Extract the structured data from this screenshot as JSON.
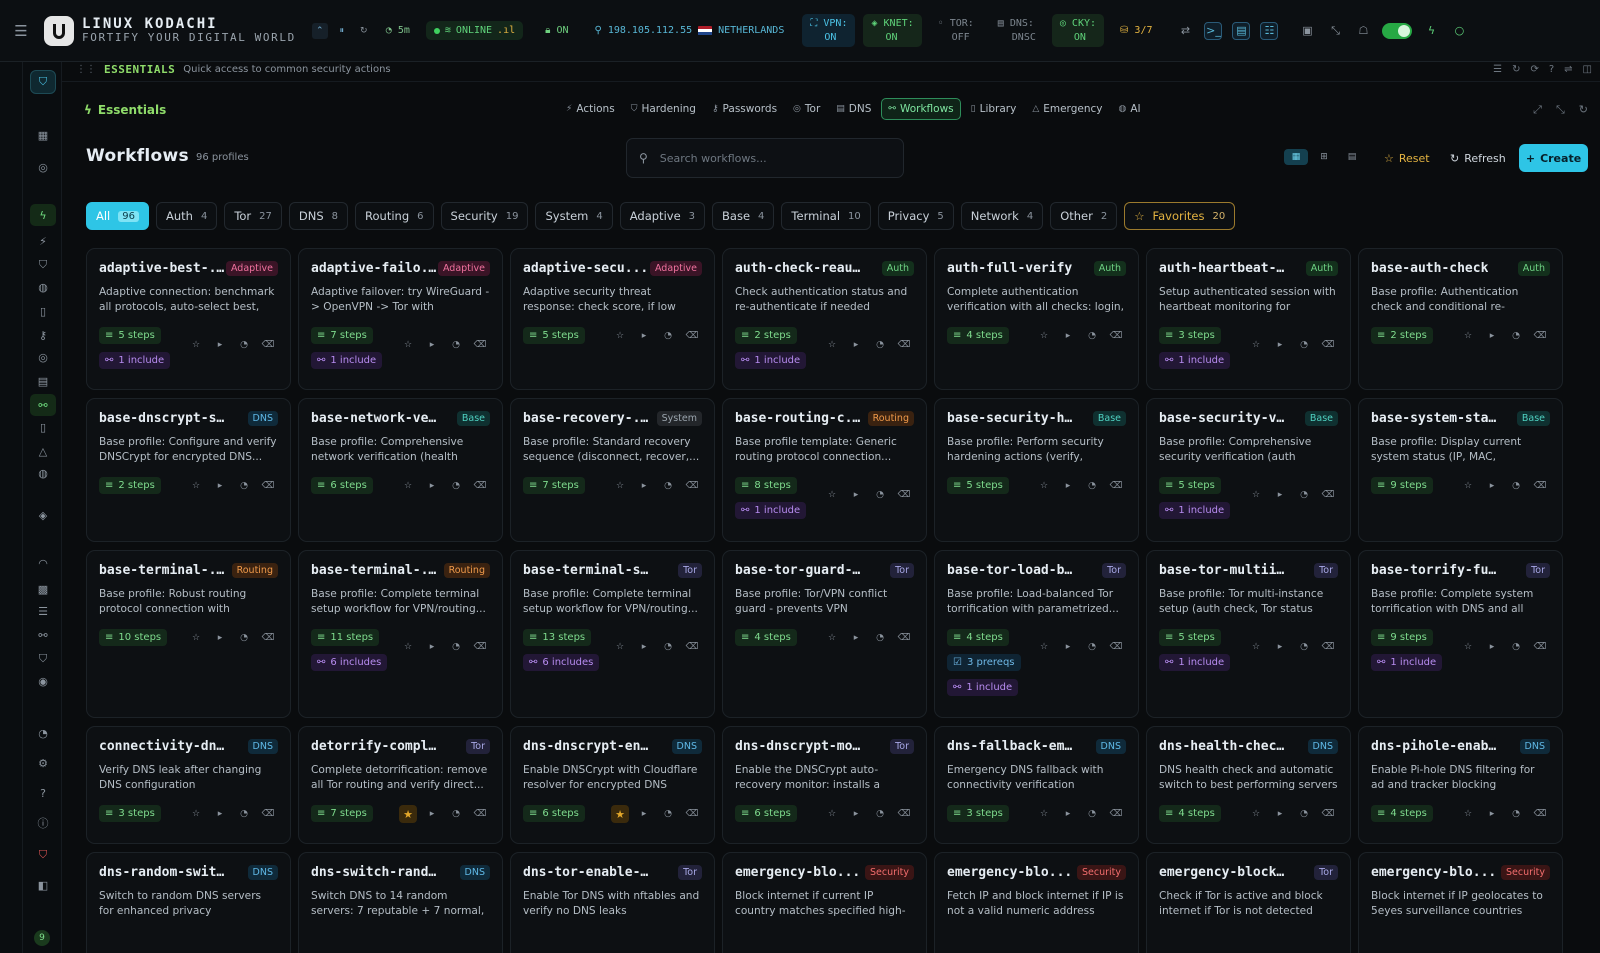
{
  "brand": {
    "title": "LINUX KODACHI",
    "subtitle": "FORTIFY YOUR DIGITAL WORLD"
  },
  "topbar": {
    "timer": "5m",
    "online": "ONLINE",
    "on_label": "ON",
    "ip": "198.105.112.55",
    "country": "NETHERLANDS",
    "vpn": {
      "l1": "VPN:",
      "l2": "ON"
    },
    "knet": {
      "l1": "KNET:",
      "l2": "ON"
    },
    "tor": {
      "l1": "TOR:",
      "l2": "OFF"
    },
    "dns": {
      "l1": "DNS:",
      "l2": "DNSC"
    },
    "cky": {
      "l1": "CKY:",
      "l2": "ON"
    },
    "lock": "3/7"
  },
  "essentials": {
    "bar_title": "ESSENTIALS",
    "bar_sub": "Quick access to common security actions",
    "title": "Essentials",
    "tabs": [
      {
        "label": "Actions",
        "icon": "⚡"
      },
      {
        "label": "Hardening",
        "icon": "⛉"
      },
      {
        "label": "Passwords",
        "icon": "⚷"
      },
      {
        "label": "Tor",
        "icon": "◎"
      },
      {
        "label": "DNS",
        "icon": "▤"
      },
      {
        "label": "Workflows",
        "icon": "⚯"
      },
      {
        "label": "Library",
        "icon": "▯"
      },
      {
        "label": "Emergency",
        "icon": "△"
      },
      {
        "label": "AI",
        "icon": "◍"
      }
    ]
  },
  "workflows": {
    "title": "Workflows",
    "count": "96 profiles",
    "search_placeholder": "Search workflows...",
    "reset": "Reset",
    "refresh": "Refresh",
    "create": "Create"
  },
  "filters": [
    {
      "label": "All",
      "count": "96"
    },
    {
      "label": "Auth",
      "count": "4"
    },
    {
      "label": "Tor",
      "count": "27"
    },
    {
      "label": "DNS",
      "count": "8"
    },
    {
      "label": "Routing",
      "count": "6"
    },
    {
      "label": "Security",
      "count": "19"
    },
    {
      "label": "System",
      "count": "4"
    },
    {
      "label": "Adaptive",
      "count": "3"
    },
    {
      "label": "Base",
      "count": "4"
    },
    {
      "label": "Terminal",
      "count": "10"
    },
    {
      "label": "Privacy",
      "count": "5"
    },
    {
      "label": "Network",
      "count": "4"
    },
    {
      "label": "Other",
      "count": "2"
    },
    {
      "label": "Favorites",
      "count": "20"
    }
  ],
  "cards": [
    {
      "name": "adaptive-best-...",
      "badge": "Adaptive",
      "desc": "Adaptive connection: benchmark all protocols, auto-select best, and...",
      "steps": "5 steps",
      "include": "1 include"
    },
    {
      "name": "adaptive-failo...",
      "badge": "Adaptive",
      "desc": "Adaptive failover: try WireGuard -> OpenVPN -> Tor with automatic...",
      "steps": "7 steps",
      "include": "1 include"
    },
    {
      "name": "adaptive-secu...",
      "badge": "Adaptive",
      "desc": "Adaptive security threat response: check score, if low harden, panic if...",
      "steps": "5 steps"
    },
    {
      "name": "auth-check-reauth",
      "badge": "Auth",
      "desc": "Check authentication status and re-authenticate if needed",
      "steps": "2 steps",
      "include": "1 include"
    },
    {
      "name": "auth-full-verify",
      "badge": "Auth",
      "desc": "Complete authentication verification with all checks: login, IDs, heartbe...",
      "steps": "4 steps"
    },
    {
      "name": "auth-heartbeat-s...",
      "badge": "Auth",
      "desc": "Setup authenticated session with heartbeat monitoring for continuou...",
      "steps": "3 steps",
      "include": "1 include"
    },
    {
      "name": "base-auth-check",
      "badge": "Auth",
      "desc": "Base profile: Authentication check and conditional re-authentication....",
      "steps": "2 steps"
    },
    {
      "name": "base-dnscrypt-se...",
      "badge": "DNS",
      "desc": "Base profile: Configure and verify DNSCrypt for encrypted DNS...",
      "steps": "2 steps"
    },
    {
      "name": "base-network-ve...",
      "badge": "Base",
      "desc": "Base profile: Comprehensive network verification (health check, ...",
      "steps": "6 steps"
    },
    {
      "name": "base-recovery-...",
      "badge": "System",
      "desc": "Base profile: Standard recovery sequence (disconnect, recover,...",
      "steps": "7 steps"
    },
    {
      "name": "base-routing-c...",
      "badge": "Routing",
      "desc": "Base profile template: Generic routing protocol connection...",
      "steps": "8 steps",
      "include": "1 include"
    },
    {
      "name": "base-security-ha...",
      "badge": "Base",
      "desc": "Base profile: Perform security hardening actions (verify, conditio...",
      "steps": "5 steps"
    },
    {
      "name": "base-security-ve...",
      "badge": "Base",
      "desc": "Base profile: Comprehensive security verification (auth check,...",
      "steps": "5 steps",
      "include": "1 include"
    },
    {
      "name": "base-system-sta...",
      "badge": "Base",
      "desc": "Base profile: Display current system status (IP, MAC, hostname,...",
      "steps": "9 steps"
    },
    {
      "name": "base-terminal-...",
      "badge": "Routing",
      "desc": "Base profile: Robust routing protocol connection with recovery fallback....",
      "steps": "10 steps"
    },
    {
      "name": "base-terminal-...",
      "badge": "Routing",
      "desc": "Base profile: Complete terminal setup workflow for VPN/routing...",
      "steps": "11 steps",
      "include": "6 includes"
    },
    {
      "name": "base-terminal-set...",
      "badge": "Tor",
      "desc": "Base profile: Complete terminal setup workflow for VPN/routing...",
      "steps": "13 steps",
      "include": "6 includes"
    },
    {
      "name": "base-tor-guard-vpn",
      "badge": "Tor",
      "desc": "Base profile: Tor/VPN conflict guard - prevents VPN connections while...",
      "steps": "4 steps"
    },
    {
      "name": "base-tor-load-bal...",
      "badge": "Tor",
      "desc": "Base profile: Load-balanced Tor torrification with parametrized...",
      "steps": "4 steps",
      "prereqs": "3 prereqs",
      "include": "1 include"
    },
    {
      "name": "base-tor-multiins...",
      "badge": "Tor",
      "desc": "Base profile: Tor multi-instance setup (auth check, Tor status chec...",
      "steps": "5 steps",
      "include": "1 include"
    },
    {
      "name": "base-torrify-full",
      "badge": "Tor",
      "desc": "Base profile: Complete system torrification with DNS and all traffic...",
      "steps": "9 steps",
      "include": "1 include"
    },
    {
      "name": "connectivity-dns...",
      "badge": "DNS",
      "desc": "Verify DNS leak after changing DNS configuration",
      "steps": "3 steps"
    },
    {
      "name": "detorrify-complet...",
      "badge": "Tor",
      "desc": "Complete detorrification: remove all Tor routing and verify direct...",
      "steps": "7 steps",
      "fav": true
    },
    {
      "name": "dns-dnscrypt-en...",
      "badge": "DNS",
      "desc": "Enable DNSCrypt with Cloudflare resolver for encrypted DNS queries",
      "steps": "6 steps",
      "fav": true
    },
    {
      "name": "dns-dnscrypt-mon...",
      "badge": "Tor",
      "desc": "Enable the DNSCrypt auto-recovery monitor: installs a systemd timer th...",
      "steps": "6 steps"
    },
    {
      "name": "dns-fallback-em...",
      "badge": "DNS",
      "desc": "Emergency DNS fallback with connectivity verification",
      "steps": "3 steps"
    },
    {
      "name": "dns-health-check...",
      "badge": "DNS",
      "desc": "DNS health check and automatic switch to best performing servers",
      "steps": "4 steps"
    },
    {
      "name": "dns-pihole-enable",
      "badge": "DNS",
      "desc": "Enable Pi-hole DNS filtering for ad and tracker blocking",
      "steps": "4 steps"
    },
    {
      "name": "dns-random-swit...",
      "badge": "DNS",
      "desc": "Switch to random DNS servers for enhanced privacy",
      "steps": ""
    },
    {
      "name": "dns-switch-rand...",
      "badge": "DNS",
      "desc": "Switch DNS to 14 random servers: 7 reputable + 7 normal, with health...",
      "steps": ""
    },
    {
      "name": "dns-tor-enable-ve...",
      "badge": "Tor",
      "desc": "Enable Tor DNS with nftables and verify no DNS leaks",
      "steps": ""
    },
    {
      "name": "emergency-blo...",
      "badge": "Security",
      "desc": "Block internet if current IP country matches specified high-risk countr...",
      "steps": ""
    },
    {
      "name": "emergency-blo...",
      "badge": "Security",
      "desc": "Fetch IP and block internet if IP is not a valid numeric address",
      "steps": ""
    },
    {
      "name": "emergency-block-...",
      "badge": "Tor",
      "desc": "Check if Tor is active and block internet if Tor is not detected",
      "steps": ""
    },
    {
      "name": "emergency-blo...",
      "badge": "Security",
      "desc": "Block internet if IP geolocates to 5eyes surveillance countries",
      "steps": ""
    }
  ],
  "rail_badge": "9"
}
